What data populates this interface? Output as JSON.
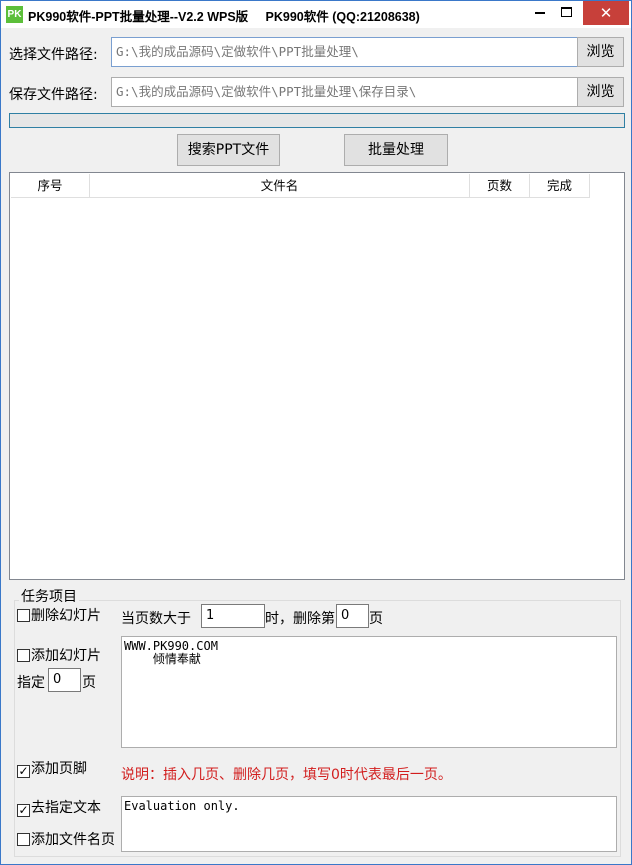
{
  "window": {
    "icon_text": "PK",
    "title": "PK990软件-PPT批量处理--V2.2 WPS版     PK990软件 (QQ:21208638)",
    "close_glyph": "✕"
  },
  "paths": {
    "source_label": "选择文件路径:",
    "source_value": "G:\\我的成品源码\\定做软件\\PPT批量处理\\",
    "save_label": "保存文件路径:",
    "save_value": "G:\\我的成品源码\\定做软件\\PPT批量处理\\保存目录\\",
    "browse_label": "浏览"
  },
  "progress": {
    "value": 0
  },
  "actions": {
    "search_label": "搜索PPT文件",
    "process_label": "批量处理"
  },
  "list": {
    "columns": [
      "序号",
      "文件名",
      "页数",
      "完成"
    ],
    "rows": []
  },
  "tasks": {
    "group_title": "任务项目",
    "delete_slide": {
      "label": "删除幻灯片",
      "checked": false,
      "when_label": "当页数大于",
      "when_value": "1",
      "then_label": "时，删除第",
      "page_value": "0",
      "page_unit": "页"
    },
    "add_slide": {
      "label": "添加幻灯片",
      "checked": false,
      "at_label": "指定",
      "at_value": "0",
      "at_unit": "页",
      "content": "WWW.PK990.COM\n    倾情奉献"
    },
    "add_footer": {
      "label": "添加页脚",
      "checked": true
    },
    "note": "说明：插入几页、删除几页，填写0时代表最后一页。",
    "remove_text": {
      "label": "去指定文本",
      "checked": true,
      "content": "Evaluation only."
    },
    "add_filename_page": {
      "label": "添加文件名页",
      "checked": false
    }
  }
}
